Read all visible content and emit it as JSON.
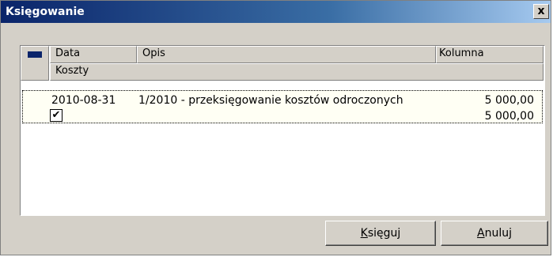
{
  "window": {
    "title": "Księgowanie",
    "close_label": "x"
  },
  "table": {
    "headers": {
      "data": "Data",
      "opis": "Opis",
      "kolumna": "Kolumna",
      "koszty": "Koszty"
    },
    "rows": [
      {
        "date": "2010-08-31",
        "description": "1/2010 - przeksięgowanie kosztów odroczonych",
        "amount_kolumna": "5 000,00",
        "amount_koszty": "5 000,00",
        "checked": true,
        "check_glyph": "✔"
      }
    ]
  },
  "buttons": {
    "ksieguj_first": "K",
    "ksieguj_rest": "sięguj",
    "anuluj_first": "A",
    "anuluj_rest": "nuluj"
  }
}
